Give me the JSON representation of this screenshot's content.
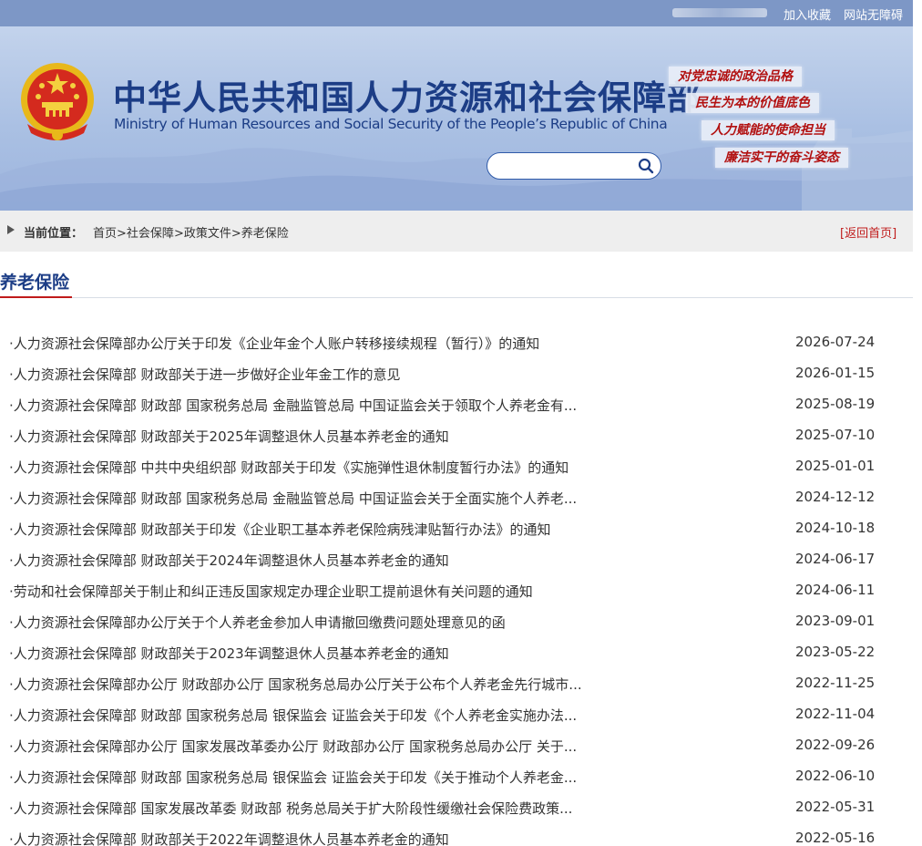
{
  "topbar": {
    "links": [
      "加入收藏",
      "网站无障碍"
    ]
  },
  "header": {
    "title_cn": "中华人民共和国人力资源和社会保障部",
    "title_en": "Ministry of Human Resources and Social Security of the People’s Republic of China",
    "search": {
      "placeholder": "",
      "value": ""
    },
    "slogans": [
      "对党忠诚的政治品格",
      "民生为本的价值底色",
      "人力赋能的使命担当",
      "廉洁实干的奋斗姿态"
    ]
  },
  "breadcrumb": {
    "label": "当前位置：",
    "items": [
      "首页",
      "社会保障",
      "政策文件",
      "养老保险"
    ],
    "separator": ">",
    "back_label": "[返回首页]"
  },
  "section": {
    "title": "养老保险"
  },
  "articles": [
    {
      "title": "·人力资源社会保障部办公厅关于印发《企业年金个人账户转移接续规程（暂行）》的通知",
      "date": "2026-07-24"
    },
    {
      "title": "·人力资源社会保障部 财政部关于进一步做好企业年金工作的意见",
      "date": "2026-01-15"
    },
    {
      "title": "·人力资源社会保障部 财政部 国家税务总局 金融监管总局 中国证监会关于领取个人养老金有...",
      "date": "2025-08-19"
    },
    {
      "title": "·人力资源社会保障部 财政部关于2025年调整退休人员基本养老金的通知",
      "date": "2025-07-10"
    },
    {
      "title": "·人力资源社会保障部 中共中央组织部 财政部关于印发《实施弹性退休制度暂行办法》的通知",
      "date": "2025-01-01"
    },
    {
      "title": "·人力资源社会保障部 财政部 国家税务总局 金融监管总局 中国证监会关于全面实施个人养老...",
      "date": "2024-12-12"
    },
    {
      "title": "·人力资源社会保障部 财政部关于印发《企业职工基本养老保险病残津贴暂行办法》的通知",
      "date": "2024-10-18"
    },
    {
      "title": "·人力资源社会保障部 财政部关于2024年调整退休人员基本养老金的通知",
      "date": "2024-06-17"
    },
    {
      "title": "·劳动和社会保障部关于制止和纠正违反国家规定办理企业职工提前退休有关问题的通知",
      "date": "2024-06-11"
    },
    {
      "title": "·人力资源社会保障部办公厅关于个人养老金参加人申请撤回缴费问题处理意见的函",
      "date": "2023-09-01"
    },
    {
      "title": "·人力资源社会保障部 财政部关于2023年调整退休人员基本养老金的通知",
      "date": "2023-05-22"
    },
    {
      "title": "·人力资源社会保障部办公厅 财政部办公厅 国家税务总局办公厅关于公布个人养老金先行城市...",
      "date": "2022-11-25"
    },
    {
      "title": "·人力资源社会保障部 财政部 国家税务总局 银保监会 证监会关于印发《个人养老金实施办法...",
      "date": "2022-11-04"
    },
    {
      "title": "·人力资源社会保障部办公厅 国家发展改革委办公厅 财政部办公厅 国家税务总局办公厅 关于...",
      "date": "2022-09-26"
    },
    {
      "title": "·人力资源社会保障部 财政部 国家税务总局 银保监会 证监会关于印发《关于推动个人养老金...",
      "date": "2022-06-10"
    },
    {
      "title": "·人力资源社会保障部 国家发展改革委 财政部 税务总局关于扩大阶段性缓缴社会保险费政策...",
      "date": "2022-05-31"
    },
    {
      "title": "·人力资源社会保障部 财政部关于2022年调整退休人员基本养老金的通知",
      "date": "2022-05-16"
    }
  ]
}
